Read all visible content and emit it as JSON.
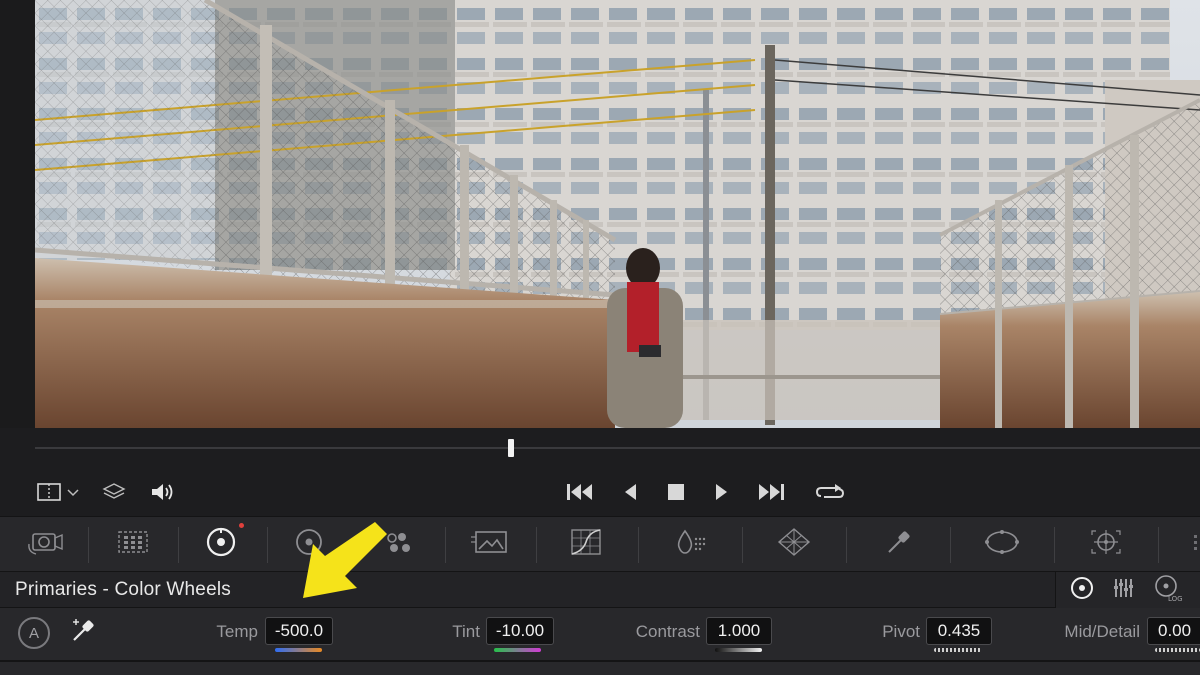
{
  "viewer": {
    "scene": "footage-frame"
  },
  "transport": {
    "buttons": [
      "viewer-mode",
      "layers",
      "audio",
      "jump-start",
      "play-reverse",
      "stop",
      "play",
      "jump-end",
      "loop"
    ]
  },
  "palette": {
    "tools": [
      "camera-raw",
      "color-match",
      "color-wheels",
      "rgb-mixer",
      "motion-effects",
      "curves",
      "qualifier",
      "color-warper",
      "eyedropper-window",
      "power-window",
      "tracker"
    ],
    "active": "color-wheels"
  },
  "panel": {
    "title": "Primaries - Color Wheels",
    "modes": [
      "wheels",
      "bars",
      "log"
    ]
  },
  "adjust": {
    "auto_label": "A",
    "temp_label": "Temp",
    "temp_value": "-500.0",
    "tint_label": "Tint",
    "tint_value": "-10.00",
    "contrast_label": "Contrast",
    "contrast_value": "1.000",
    "pivot_label": "Pivot",
    "pivot_value": "0.435",
    "middetail_label": "Mid/Detail",
    "middetail_value": "0.00"
  },
  "colors": {
    "annotation_arrow": "#f5e31a",
    "active_dot": "#e0403c"
  }
}
